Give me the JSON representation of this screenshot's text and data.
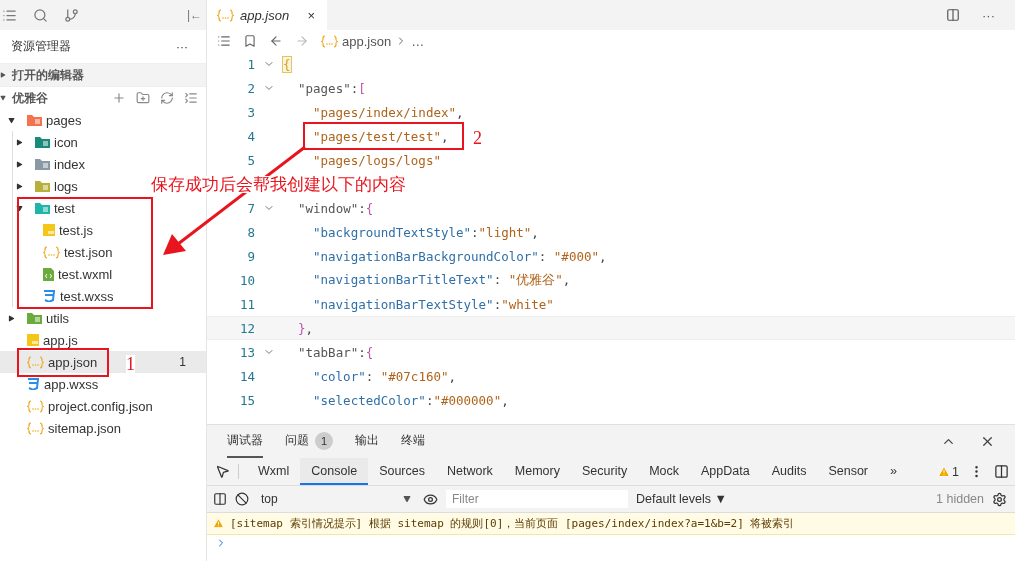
{
  "activity_bar": {
    "collapse_label": "|←"
  },
  "sidebar": {
    "title": "资源管理器",
    "more": "···",
    "sections": [
      {
        "label": "打开的编辑器",
        "expanded": false
      },
      {
        "label": "优雅谷",
        "expanded": true
      }
    ],
    "tree": [
      {
        "label": "pages",
        "kind": "folder",
        "color": "#f4734f",
        "expanded": true,
        "selected": false,
        "children": [
          {
            "label": "icon",
            "kind": "folder",
            "color": "#1a8a7a",
            "expanded": false,
            "selected": false
          },
          {
            "label": "index",
            "kind": "folder",
            "color": "#8a99a6",
            "expanded": false,
            "selected": false
          },
          {
            "label": "logs",
            "kind": "folder",
            "color": "#b7b03a",
            "expanded": false,
            "selected": false
          },
          {
            "label": "test",
            "kind": "folder",
            "color": "#1fb5a8",
            "expanded": true,
            "selected": false,
            "children": [
              {
                "label": "test.js",
                "kind": "js",
                "selected": false
              },
              {
                "label": "test.json",
                "kind": "json",
                "selected": false
              },
              {
                "label": "test.wxml",
                "kind": "wxml",
                "selected": false
              },
              {
                "label": "test.wxss",
                "kind": "wxss",
                "selected": false
              }
            ]
          }
        ]
      },
      {
        "label": "utils",
        "kind": "folder",
        "color": "#6aab3c",
        "expanded": false,
        "selected": false
      },
      {
        "label": "app.js",
        "kind": "js",
        "selected": false
      },
      {
        "label": "app.json",
        "kind": "json",
        "selected": true,
        "badge": "1"
      },
      {
        "label": "app.wxss",
        "kind": "wxss",
        "selected": false
      },
      {
        "label": "project.config.json",
        "kind": "json",
        "selected": false
      },
      {
        "label": "sitemap.json",
        "kind": "json",
        "selected": false
      }
    ]
  },
  "editor": {
    "tab": {
      "label": "app.json",
      "close": "×"
    },
    "breadcrumb": [
      "app.json",
      "…"
    ],
    "lines": [
      {
        "num": "1",
        "fold": true,
        "kind": "root",
        "current": false,
        "tokens": [
          {
            "t": "{",
            "kind": "match"
          }
        ]
      },
      {
        "num": "2",
        "fold": true,
        "kind": "member",
        "current": false,
        "tokens": [
          {
            "t": "\"pages\"",
            "kind": "key"
          },
          {
            "t": ":",
            "kind": "punct"
          },
          {
            "t": "[",
            "kind": "bracket"
          }
        ]
      },
      {
        "num": "3",
        "fold": false,
        "kind": "item",
        "current": false,
        "tokens": [
          {
            "t": "\"pages/index/index\"",
            "kind": "str"
          },
          {
            "t": ",",
            "kind": "punct"
          }
        ]
      },
      {
        "num": "4",
        "fold": false,
        "kind": "item",
        "current": false,
        "tokens": [
          {
            "t": "\"pages/test/test\"",
            "kind": "str"
          },
          {
            "t": ",",
            "kind": "punct"
          }
        ]
      },
      {
        "num": "5",
        "fold": false,
        "kind": "item",
        "current": false,
        "tokens": [
          {
            "t": "\"pages/logs/logs\"",
            "kind": "str"
          }
        ]
      },
      {
        "current": false
      },
      {
        "num": "7",
        "fold": true,
        "kind": "member",
        "current": false,
        "tokens": [
          {
            "t": "\"window\"",
            "kind": "key"
          },
          {
            "t": ":",
            "kind": "punct"
          },
          {
            "t": "{",
            "kind": "bracket"
          }
        ]
      },
      {
        "num": "8",
        "fold": false,
        "kind": "item",
        "current": false,
        "tokens": [
          {
            "t": "\"backgroundTextStyle\"",
            "kind": "prop"
          },
          {
            "t": ":",
            "kind": "punct"
          },
          {
            "t": "\"light\"",
            "kind": "str"
          },
          {
            "t": ",",
            "kind": "punct"
          }
        ]
      },
      {
        "num": "9",
        "fold": false,
        "kind": "item",
        "current": false,
        "tokens": [
          {
            "t": "\"navigationBarBackgroundColor\"",
            "kind": "prop"
          },
          {
            "t": ": ",
            "kind": "punct"
          },
          {
            "t": "\"#000\"",
            "kind": "str"
          },
          {
            "t": ",",
            "kind": "punct"
          }
        ]
      },
      {
        "num": "10",
        "fold": false,
        "kind": "item",
        "current": false,
        "tokens": [
          {
            "t": "\"navigationBarTitleText\"",
            "kind": "prop"
          },
          {
            "t": ": ",
            "kind": "punct"
          },
          {
            "t": "\"优雅谷\"",
            "kind": "str"
          },
          {
            "t": ",",
            "kind": "punct"
          }
        ]
      },
      {
        "num": "11",
        "fold": false,
        "kind": "item",
        "current": false,
        "tokens": [
          {
            "t": "\"navigationBarTextStyle\"",
            "kind": "prop"
          },
          {
            "t": ":",
            "kind": "punct"
          },
          {
            "t": "\"white\"",
            "kind": "str"
          }
        ]
      },
      {
        "num": "12",
        "fold": false,
        "kind": "member",
        "current": true,
        "tokens": [
          {
            "t": "}",
            "kind": "bracket"
          },
          {
            "t": ",",
            "kind": "punct"
          }
        ]
      },
      {
        "num": "13",
        "fold": true,
        "kind": "member",
        "current": false,
        "tokens": [
          {
            "t": "\"tabBar\"",
            "kind": "key"
          },
          {
            "t": ":",
            "kind": "punct"
          },
          {
            "t": "{",
            "kind": "bracket"
          }
        ]
      },
      {
        "num": "14",
        "fold": false,
        "kind": "item",
        "current": false,
        "tokens": [
          {
            "t": "\"color\"",
            "kind": "prop"
          },
          {
            "t": ": ",
            "kind": "punct"
          },
          {
            "t": "\"#07c160\"",
            "kind": "str"
          },
          {
            "t": ",",
            "kind": "punct"
          }
        ]
      },
      {
        "num": "15",
        "fold": false,
        "kind": "item",
        "current": false,
        "tokens": [
          {
            "t": "\"selectedColor\"",
            "kind": "prop"
          },
          {
            "t": ":",
            "kind": "punct"
          },
          {
            "t": "\"#000000\"",
            "kind": "str"
          },
          {
            "t": ",",
            "kind": "punct"
          }
        ]
      }
    ]
  },
  "panel": {
    "tabs": [
      {
        "label": "调试器",
        "selected": true
      },
      {
        "label": "问题",
        "selected": false,
        "badge": "1"
      },
      {
        "label": "输出",
        "selected": false
      },
      {
        "label": "终端",
        "selected": false
      }
    ],
    "devtools_tabs": [
      {
        "label": "Wxml",
        "selected": false
      },
      {
        "label": "Console",
        "selected": true
      },
      {
        "label": "Sources",
        "selected": false
      },
      {
        "label": "Network",
        "selected": false
      },
      {
        "label": "Memory",
        "selected": false
      },
      {
        "label": "Security",
        "selected": false
      },
      {
        "label": "Mock",
        "selected": false
      },
      {
        "label": "AppData",
        "selected": false
      },
      {
        "label": "Audits",
        "selected": false
      },
      {
        "label": "Sensor",
        "selected": false
      }
    ],
    "more_tabs": "»",
    "warning_count": "1",
    "context": "top",
    "filter": {
      "placeholder": "Filter"
    },
    "levels": "Default levels ▼",
    "hidden": "1 hidden",
    "messages": [
      {
        "kind": "warning",
        "text": "[sitemap 索引情况提示] 根据 sitemap 的规则[0]，当前页面 [pages/index/index?a=1&b=2] 将被索引"
      }
    ]
  },
  "annotations": {
    "note": "保存成功后会帮我创建以下的内容",
    "markers": [
      "1",
      "2"
    ]
  }
}
